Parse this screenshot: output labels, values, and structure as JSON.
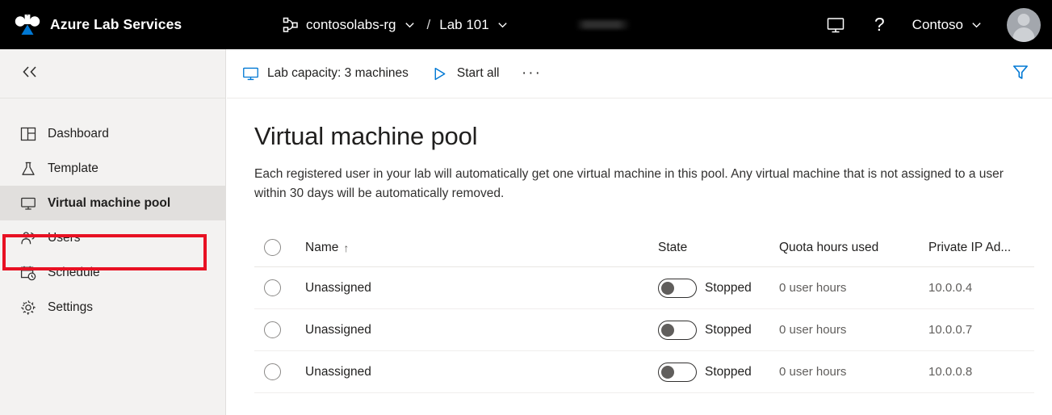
{
  "topbar": {
    "brand_title": "Azure Lab Services",
    "brand_logo_icon": "azure-lab-services-logo",
    "breadcrumb": {
      "rg_icon": "resource-group-icon",
      "resource_group": "contosolabs-rg",
      "separator": "/",
      "lab": "Lab 101",
      "chevron_icon": "chevron-down-icon"
    },
    "redacted_icon": "redacted-bar",
    "monitor_icon": "monitor-icon",
    "help_icon": "?",
    "tenant": "Contoso",
    "tenant_chevron_icon": "chevron-down-icon",
    "avatar_icon": "user-avatar"
  },
  "sidebar": {
    "collapse_icon": "double-chevron-left-icon",
    "items": [
      {
        "label": "Dashboard",
        "icon": "dashboard-icon",
        "selected": false
      },
      {
        "label": "Template",
        "icon": "flask-icon",
        "selected": false
      },
      {
        "label": "Virtual machine pool",
        "icon": "monitor-icon",
        "selected": true
      },
      {
        "label": "Users",
        "icon": "people-icon",
        "selected": false
      },
      {
        "label": "Schedule",
        "icon": "calendar-clock-icon",
        "selected": false
      },
      {
        "label": "Settings",
        "icon": "gear-icon",
        "selected": false
      }
    ],
    "highlight_color": "#e81123"
  },
  "commandbar": {
    "lab_capacity_label": "Lab capacity: 3 machines",
    "lab_capacity_icon": "monitor-icon",
    "start_all_label": "Start all",
    "start_all_icon": "play-icon",
    "more_label": "···",
    "filter_icon": "filter-funnel-icon",
    "filter_color": "#0078d4"
  },
  "main": {
    "title": "Virtual machine pool",
    "description": "Each registered user in your lab will automatically get one virtual machine in this pool. Any virtual machine that is not assigned to a user within 30 days will be automatically removed."
  },
  "table": {
    "select_all_icon": "radio-circle-unchecked",
    "columns": [
      {
        "key": "name",
        "label": "Name",
        "sort": "↑"
      },
      {
        "key": "state",
        "label": "State"
      },
      {
        "key": "quota",
        "label": "Quota hours used"
      },
      {
        "key": "ip",
        "label": "Private IP Ad..."
      }
    ],
    "rows": [
      {
        "name": "Unassigned",
        "toggle": "off",
        "state": "Stopped",
        "quota": "0 user hours",
        "ip": "10.0.0.4"
      },
      {
        "name": "Unassigned",
        "toggle": "off",
        "state": "Stopped",
        "quota": "0 user hours",
        "ip": "10.0.0.7"
      },
      {
        "name": "Unassigned",
        "toggle": "off",
        "state": "Stopped",
        "quota": "0 user hours",
        "ip": "10.0.0.8"
      }
    ]
  }
}
